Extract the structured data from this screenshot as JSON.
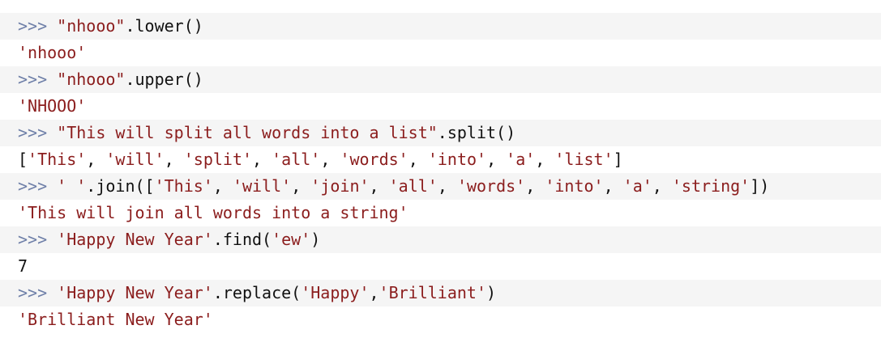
{
  "session": {
    "lines": [
      {
        "kind": "input",
        "prompt": ">>>",
        "tokens": [
          {
            "type": "str",
            "text": "\"nhooo\""
          },
          {
            "type": "plain",
            "text": ".lower()"
          }
        ]
      },
      {
        "kind": "output",
        "tokens": [
          {
            "type": "str",
            "text": "'nhooo'"
          }
        ]
      },
      {
        "kind": "input",
        "prompt": ">>>",
        "tokens": [
          {
            "type": "str",
            "text": "\"nhooo\""
          },
          {
            "type": "plain",
            "text": ".upper()"
          }
        ]
      },
      {
        "kind": "output",
        "tokens": [
          {
            "type": "str",
            "text": "'NHOOO'"
          }
        ]
      },
      {
        "kind": "input",
        "prompt": ">>>",
        "tokens": [
          {
            "type": "str",
            "text": "\"This will split all words into a list\""
          },
          {
            "type": "plain",
            "text": ".split()"
          }
        ]
      },
      {
        "kind": "output",
        "tokens": [
          {
            "type": "plain",
            "text": "["
          },
          {
            "type": "str",
            "text": "'This'"
          },
          {
            "type": "plain",
            "text": ", "
          },
          {
            "type": "str",
            "text": "'will'"
          },
          {
            "type": "plain",
            "text": ", "
          },
          {
            "type": "str",
            "text": "'split'"
          },
          {
            "type": "plain",
            "text": ", "
          },
          {
            "type": "str",
            "text": "'all'"
          },
          {
            "type": "plain",
            "text": ", "
          },
          {
            "type": "str",
            "text": "'words'"
          },
          {
            "type": "plain",
            "text": ", "
          },
          {
            "type": "str",
            "text": "'into'"
          },
          {
            "type": "plain",
            "text": ", "
          },
          {
            "type": "str",
            "text": "'a'"
          },
          {
            "type": "plain",
            "text": ", "
          },
          {
            "type": "str",
            "text": "'list'"
          },
          {
            "type": "plain",
            "text": "]"
          }
        ]
      },
      {
        "kind": "input",
        "prompt": ">>>",
        "tokens": [
          {
            "type": "str",
            "text": "' '"
          },
          {
            "type": "plain",
            "text": ".join(["
          },
          {
            "type": "str",
            "text": "'This'"
          },
          {
            "type": "plain",
            "text": ", "
          },
          {
            "type": "str",
            "text": "'will'"
          },
          {
            "type": "plain",
            "text": ", "
          },
          {
            "type": "str",
            "text": "'join'"
          },
          {
            "type": "plain",
            "text": ", "
          },
          {
            "type": "str",
            "text": "'all'"
          },
          {
            "type": "plain",
            "text": ", "
          },
          {
            "type": "str",
            "text": "'words'"
          },
          {
            "type": "plain",
            "text": ", "
          },
          {
            "type": "str",
            "text": "'into'"
          },
          {
            "type": "plain",
            "text": ", "
          },
          {
            "type": "str",
            "text": "'a'"
          },
          {
            "type": "plain",
            "text": ", "
          },
          {
            "type": "str",
            "text": "'string'"
          },
          {
            "type": "plain",
            "text": "])"
          }
        ]
      },
      {
        "kind": "output",
        "tokens": [
          {
            "type": "str",
            "text": "'This will join all words into a string'"
          }
        ]
      },
      {
        "kind": "input",
        "prompt": ">>>",
        "tokens": [
          {
            "type": "str",
            "text": "'Happy New Year'"
          },
          {
            "type": "plain",
            "text": ".find("
          },
          {
            "type": "str",
            "text": "'ew'"
          },
          {
            "type": "plain",
            "text": ")"
          }
        ]
      },
      {
        "kind": "output",
        "tokens": [
          {
            "type": "num",
            "text": "7"
          }
        ]
      },
      {
        "kind": "input",
        "prompt": ">>>",
        "tokens": [
          {
            "type": "str",
            "text": "'Happy New Year'"
          },
          {
            "type": "plain",
            "text": ".replace("
          },
          {
            "type": "str",
            "text": "'Happy'"
          },
          {
            "type": "plain",
            "text": ","
          },
          {
            "type": "str",
            "text": "'Brilliant'"
          },
          {
            "type": "plain",
            "text": ")"
          }
        ]
      },
      {
        "kind": "output",
        "tokens": [
          {
            "type": "str",
            "text": "'Brilliant New Year'"
          }
        ]
      }
    ]
  },
  "colors": {
    "prompt": "#6e7fa8",
    "string": "#8b1d1d",
    "plain": "#111111",
    "stripe": "#f5f5f5",
    "background": "#ffffff"
  }
}
